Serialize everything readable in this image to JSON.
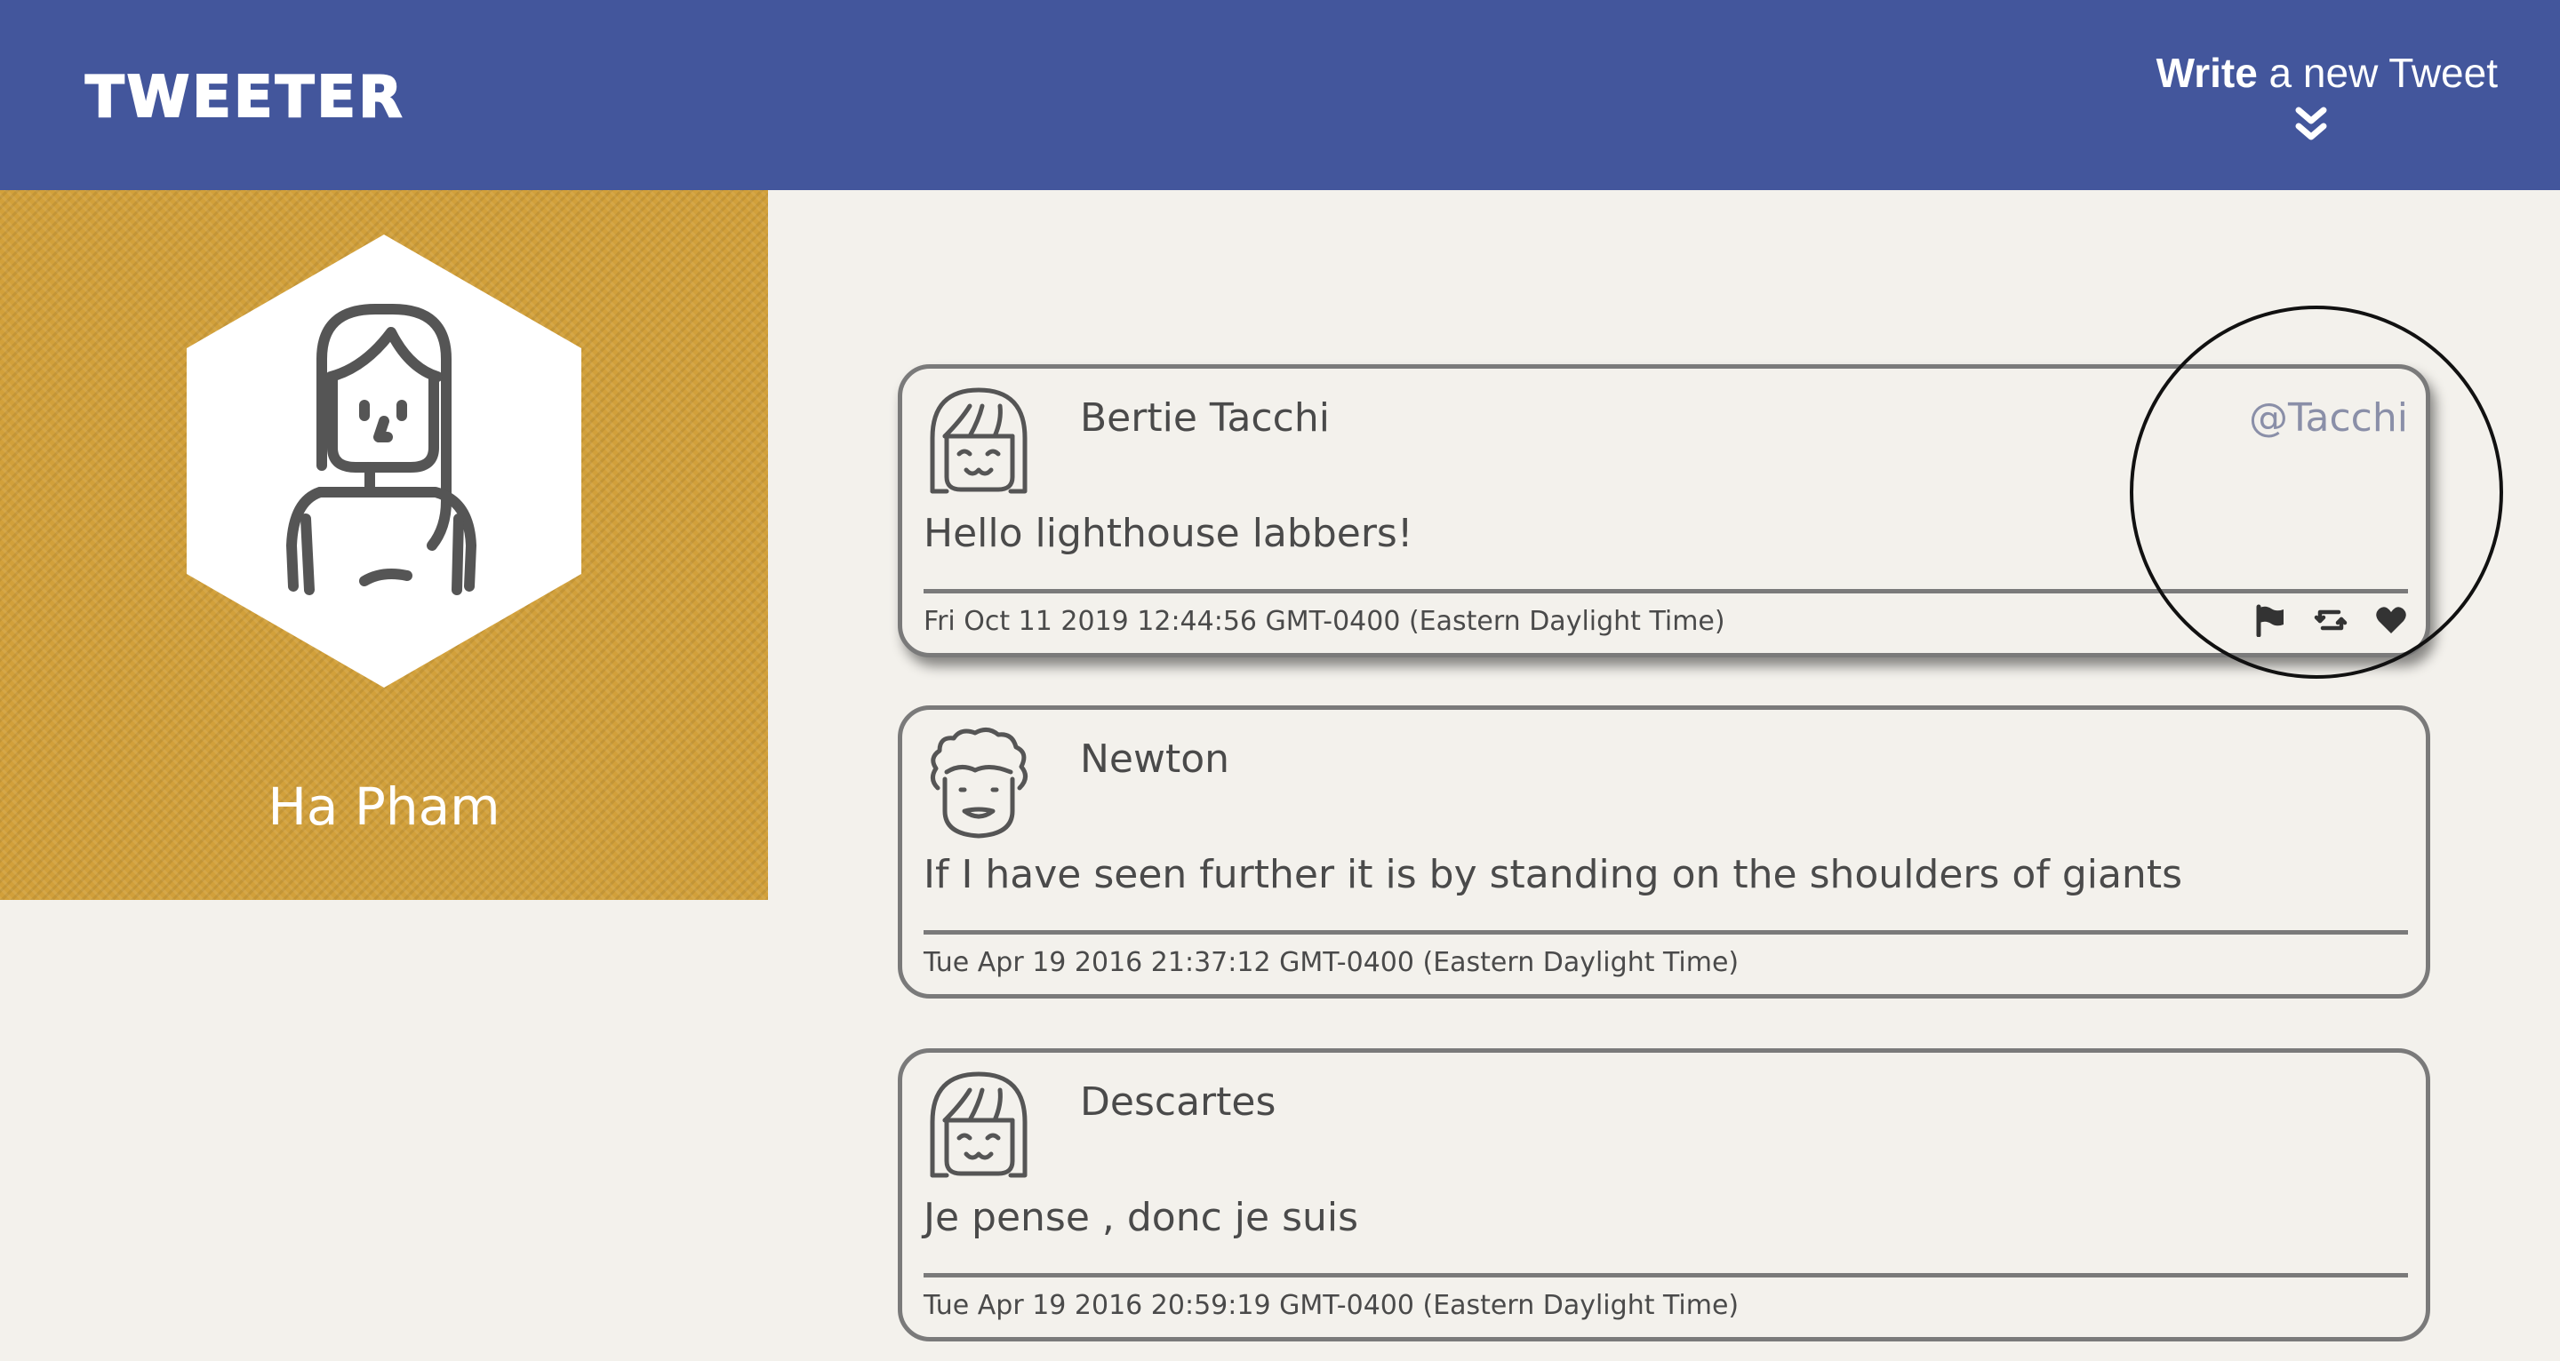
{
  "nav": {
    "logo": "TWEETER",
    "compose_strong": "Write",
    "compose_rest": " a new Tweet",
    "chevron_icon": "double-chevron-down-icon"
  },
  "profile": {
    "name": "Ha Pham",
    "avatar_icon": "girl-avatar-icon",
    "background_color": "#d2a03a"
  },
  "tweets": [
    {
      "name": "Bertie Tacchi",
      "handle": "@Tacchi",
      "body": "Hello lighthouse labbers!",
      "date": "Fri Oct 11 2019 12:44:56 GMT-0400 (Eastern Daylight Time)",
      "avatar_icon": "girl-bangs-avatar-icon",
      "actions": [
        "flag-icon",
        "retweet-icon",
        "heart-icon"
      ]
    },
    {
      "name": "Newton",
      "handle": "",
      "body": "If I have seen further it is by standing on the shoulders of giants",
      "date": "Tue Apr 19 2016 21:37:12 GMT-0400 (Eastern Daylight Time)",
      "avatar_icon": "curly-hair-avatar-icon"
    },
    {
      "name": "Descartes",
      "handle": "",
      "body": "Je pense , donc je suis",
      "date": "Tue Apr 19 2016 20:59:19 GMT-0400 (Eastern Daylight Time)",
      "avatar_icon": "girl-bangs-avatar-icon"
    }
  ],
  "colors": {
    "nav": "#43569c",
    "page_background": "#f3f1ec",
    "text": "#4a4a4a",
    "handle": "#8a8fa8",
    "border": "#7a7a7a"
  }
}
